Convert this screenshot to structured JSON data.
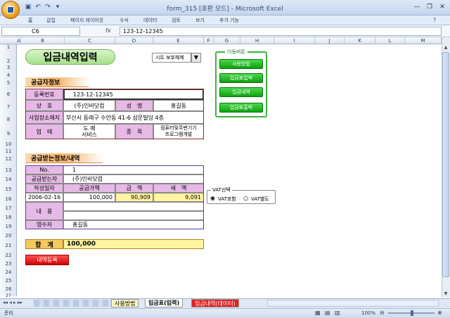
{
  "window": {
    "title": "form_315  [호환 모드] - Microsoft Excel"
  },
  "ribbon_tabs": [
    "홈",
    "삽입",
    "페이지 레이아웃",
    "수식",
    "데이터",
    "검토",
    "보기",
    "추가 기능"
  ],
  "formula_bar": {
    "name_box": "C6",
    "fx": "fx",
    "content": "123-12-12345"
  },
  "columns": [
    "A",
    "B",
    "C",
    "D",
    "E",
    "F",
    "G",
    "H",
    "I",
    "J",
    "K",
    "L",
    "M"
  ],
  "rows": [
    "1",
    "2",
    "3",
    "4",
    "5",
    "6",
    "7",
    "8",
    "9",
    "10",
    "11",
    "12",
    "13",
    "14",
    "15",
    "16",
    "17",
    "18",
    "19",
    "20",
    "21",
    "22",
    "23",
    "24",
    "25",
    "26",
    "27"
  ],
  "sheet": {
    "title": "입금내역입력",
    "protect_select": "시트 보호해제",
    "nav_title": "이동버튼",
    "nav_buttons": [
      "사용방법",
      "입금표입력",
      "입금내역",
      "입금표출력"
    ],
    "supplier_banner": "공급자정보",
    "reg_no_label": "등록번호",
    "reg_no": "123-12-12345",
    "company_label": "상　호",
    "company": "(주)인비닷컴",
    "name_label": "성　명",
    "name": "홍길동",
    "address_label": "사업장소재지",
    "address": "부산시 동래구 수안동 41-6 삼문빌딩 4층",
    "biztype_label": "업　태",
    "biztype": "도 매\n서비스",
    "item_label": "종　목",
    "item": "컴퓨터및주변기기\n프로그램개발",
    "receiver_banner": "공급받는정보/내역",
    "no_label": "No.",
    "no": "1",
    "receiver_label": "공급받는자",
    "receiver": "(주)인비닷컴",
    "date_label": "작성일자",
    "supply_label": "공급가액",
    "amount_label": "금　액",
    "tax_label": "세　액",
    "date": "2006-02-16",
    "supply": "100,000",
    "amount": "90,909",
    "tax": "9,091",
    "content_label": "내　용",
    "recipient_label": "영수자",
    "recipient": "홍길동",
    "total_label": "합　계",
    "total": "100,000",
    "register_button": "내역등록",
    "vat_group": "VAT선택",
    "vat_include": "VAT포함",
    "vat_exclude": "VAT별도"
  },
  "sheet_tabs": [
    "사용방법",
    "입금표(입력)",
    "입금내역(데이터)"
  ],
  "status": {
    "mode": "준비",
    "zoom": "100%"
  }
}
